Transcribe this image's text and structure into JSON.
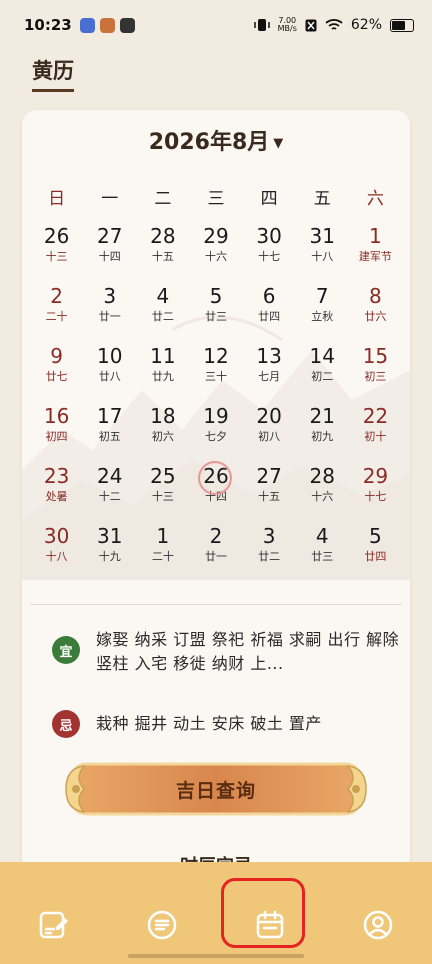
{
  "status_bar": {
    "time": "10:23",
    "speed_value": "7.00",
    "speed_unit": "MB/s",
    "battery": "62%"
  },
  "page": {
    "title": "黄历"
  },
  "calendar": {
    "month_label": "2026年8月",
    "weekdays": [
      "日",
      "一",
      "二",
      "三",
      "四",
      "五",
      "六"
    ],
    "weeks": [
      [
        {
          "d": "26",
          "l": "十三",
          "o": true
        },
        {
          "d": "27",
          "l": "十四",
          "o": true
        },
        {
          "d": "28",
          "l": "十五",
          "o": true
        },
        {
          "d": "29",
          "l": "十六",
          "o": true
        },
        {
          "d": "30",
          "l": "十七",
          "o": true
        },
        {
          "d": "31",
          "l": "十八",
          "o": true
        },
        {
          "d": "1",
          "l": "建军节",
          "f": true
        }
      ],
      [
        {
          "d": "2",
          "l": "二十"
        },
        {
          "d": "3",
          "l": "廿一"
        },
        {
          "d": "4",
          "l": "廿二"
        },
        {
          "d": "5",
          "l": "廿三"
        },
        {
          "d": "6",
          "l": "廿四"
        },
        {
          "d": "7",
          "l": "立秋"
        },
        {
          "d": "8",
          "l": "廿六"
        }
      ],
      [
        {
          "d": "9",
          "l": "廿七"
        },
        {
          "d": "10",
          "l": "廿八"
        },
        {
          "d": "11",
          "l": "廿九"
        },
        {
          "d": "12",
          "l": "三十"
        },
        {
          "d": "13",
          "l": "七月"
        },
        {
          "d": "14",
          "l": "初二"
        },
        {
          "d": "15",
          "l": "初三"
        }
      ],
      [
        {
          "d": "16",
          "l": "初四"
        },
        {
          "d": "17",
          "l": "初五"
        },
        {
          "d": "18",
          "l": "初六"
        },
        {
          "d": "19",
          "l": "七夕"
        },
        {
          "d": "20",
          "l": "初八"
        },
        {
          "d": "21",
          "l": "初九"
        },
        {
          "d": "22",
          "l": "初十"
        }
      ],
      [
        {
          "d": "23",
          "l": "处暑"
        },
        {
          "d": "24",
          "l": "十二"
        },
        {
          "d": "25",
          "l": "十三"
        },
        {
          "d": "26",
          "l": "十四",
          "s": true
        },
        {
          "d": "27",
          "l": "十五"
        },
        {
          "d": "28",
          "l": "十六"
        },
        {
          "d": "29",
          "l": "十七"
        }
      ],
      [
        {
          "d": "30",
          "l": "十八"
        },
        {
          "d": "31",
          "l": "十九"
        },
        {
          "d": "1",
          "l": "二十",
          "o": true
        },
        {
          "d": "2",
          "l": "廿一",
          "o": true
        },
        {
          "d": "3",
          "l": "廿二",
          "o": true
        },
        {
          "d": "4",
          "l": "廿三",
          "o": true
        },
        {
          "d": "5",
          "l": "廿四",
          "o": true
        }
      ]
    ]
  },
  "almanac": {
    "yi_label": "宜",
    "yi_text": "嫁娶 纳采 订盟 祭祀 祈福 求嗣 出行 解除 竖柱 入宅 移徙 纳财 上...",
    "ji_label": "忌",
    "ji_text": "栽种 掘井 动土 安床 破土 置产"
  },
  "query_button": {
    "label": "吉日查询"
  },
  "next_section": {
    "title": "时辰宜忌"
  },
  "bottom_nav": {
    "items": [
      {
        "name": "nav-notes",
        "icon": "edit-note-icon"
      },
      {
        "name": "nav-articles",
        "icon": "list-icon"
      },
      {
        "name": "nav-calendar",
        "icon": "calendar-icon",
        "active": true
      },
      {
        "name": "nav-profile",
        "icon": "user-icon"
      }
    ]
  },
  "colors": {
    "accent_red": "#8a2b25",
    "yi_green": "#3b7c3a",
    "ji_red": "#a23331",
    "nav_bg": "#f0c779",
    "highlight_red": "#e62320"
  }
}
